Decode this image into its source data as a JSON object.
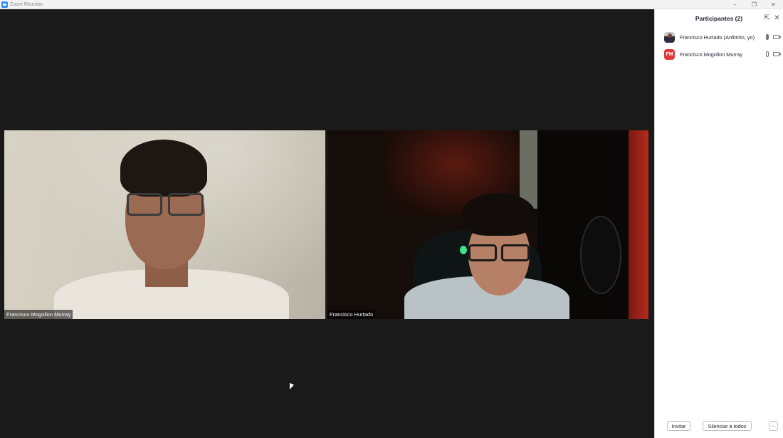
{
  "window": {
    "title": "Zoom Reunión",
    "controls": {
      "minimize": "–",
      "restore": "❐",
      "close": "✕"
    }
  },
  "tiles": [
    {
      "name": "Francisco Mogollon Murray"
    },
    {
      "name": "Francisco Hurtado"
    }
  ],
  "participants_panel": {
    "title": "Participantes (2)",
    "popout_icon": "⇱",
    "close_icon": "✕",
    "participants": [
      {
        "name": "Francisco Hurtado (Anfitrión, yo)",
        "avatar": "photo",
        "mic": "on",
        "video": "on"
      },
      {
        "name": "Francisco Mogollon Murray",
        "avatar_initials": "FM",
        "avatar_color": "#e03a3a",
        "mic": "on",
        "video": "on"
      }
    ],
    "footer": {
      "invite_label": "Invitar",
      "mute_all_label": "Silenciar a todos",
      "more_label": "···"
    }
  },
  "colors": {
    "meeting_background": "#1a1a1a",
    "accent": "#2d8cff",
    "panel_background": "#ffffff"
  }
}
